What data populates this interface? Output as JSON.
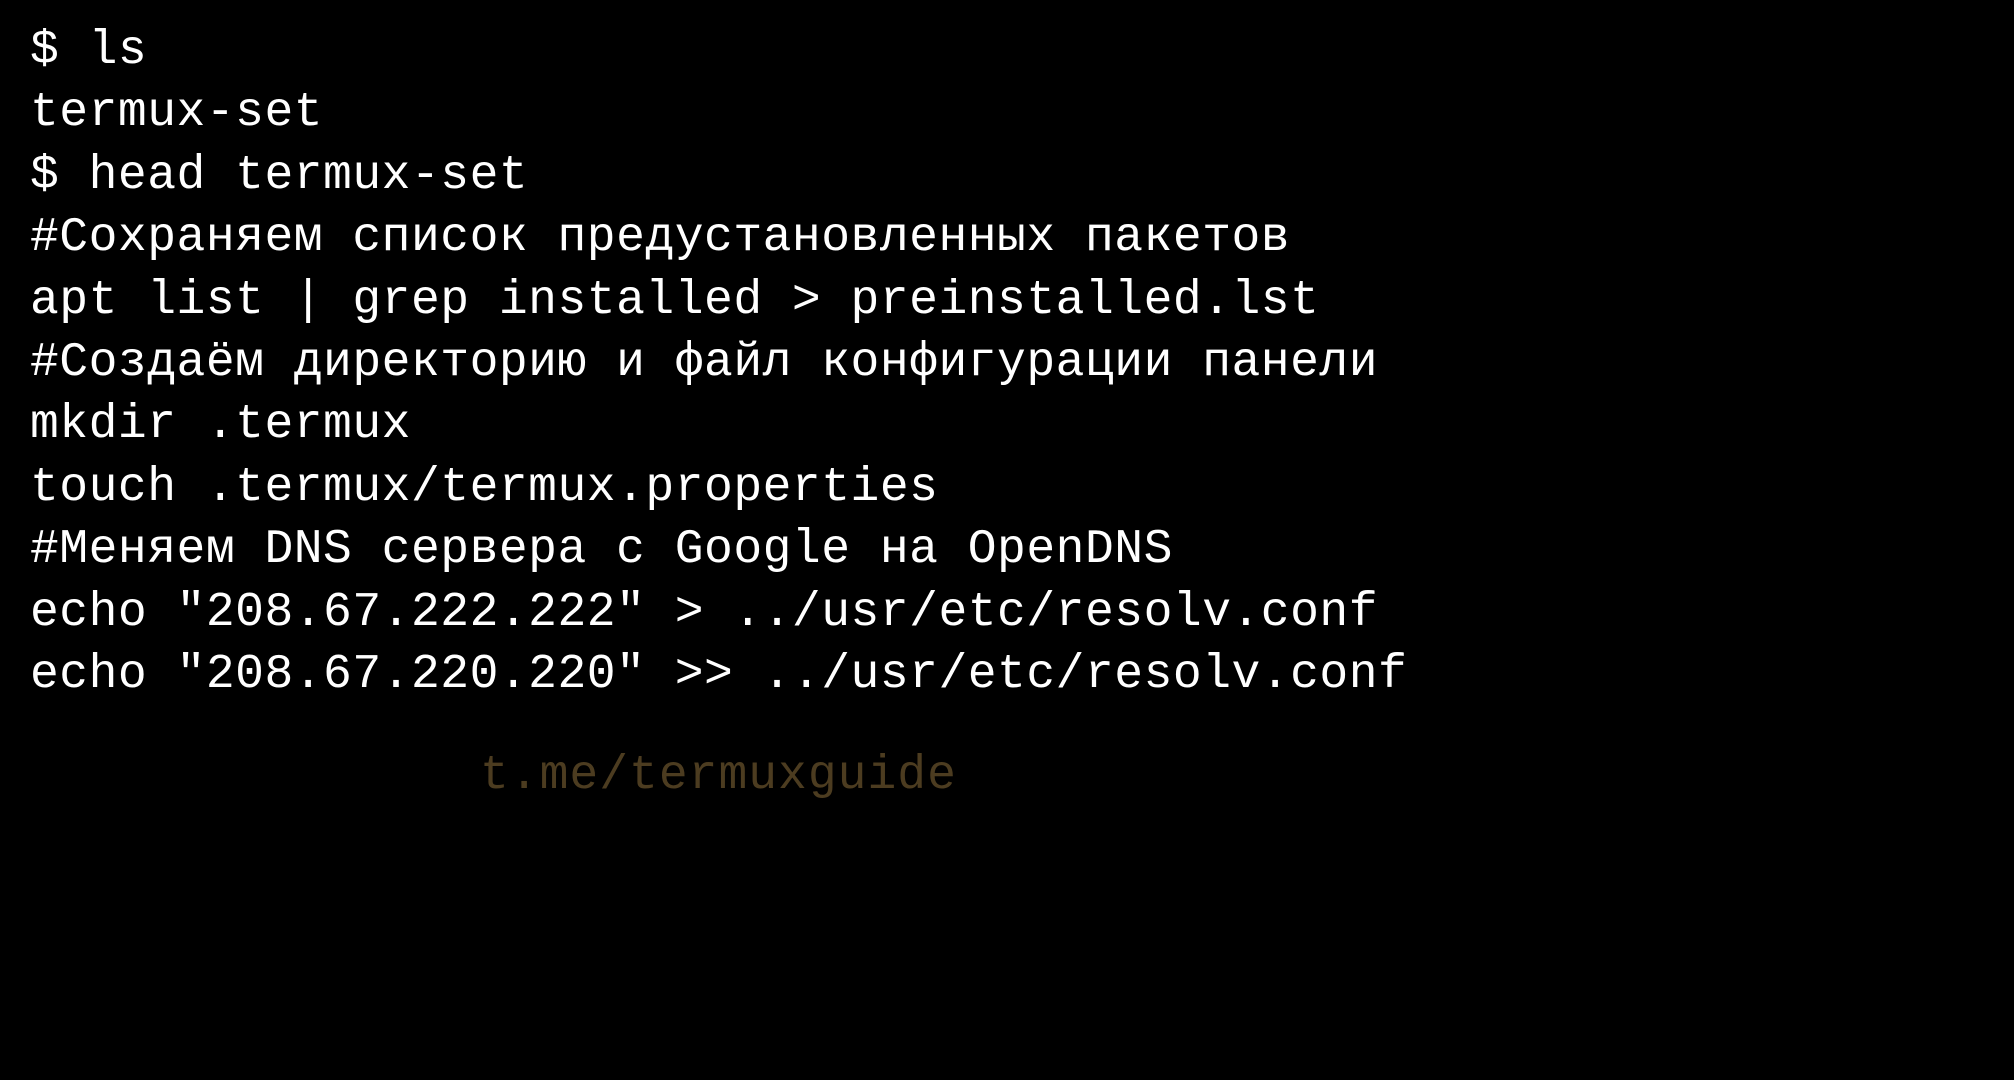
{
  "terminal": {
    "lines": [
      "$ ls",
      "termux-set",
      "$ head termux-set",
      "#Сохраняем список предустановленных пакетов",
      "apt list | grep installed > preinstalled.lst",
      "",
      "#Создаём директорию и файл конфигурации панели",
      "mkdir .termux",
      "touch .termux/termux.properties",
      "",
      "#Меняем DNS сервера с Google на OpenDNS",
      "echo \"208.67.222.222\" > ../usr/etc/resolv.conf",
      "echo \"208.67.220.220\" >> ../usr/etc/resolv.conf"
    ]
  },
  "watermark": "t.me/termuxguide"
}
